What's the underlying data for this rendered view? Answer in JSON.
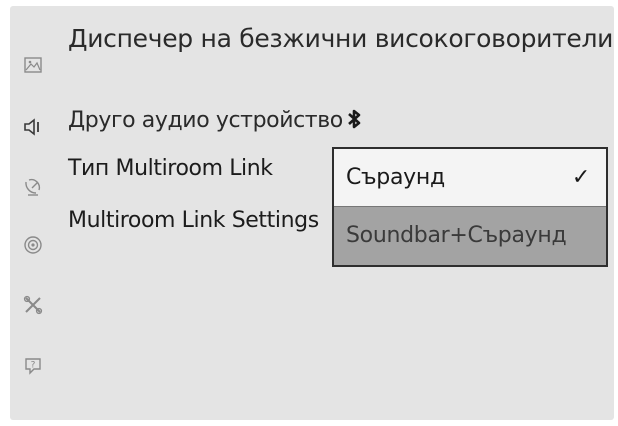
{
  "page": {
    "title": "Диспечер на безжични високоговорители"
  },
  "sidebar": {
    "icons": [
      "picture-icon",
      "sound-icon",
      "broadcast-icon",
      "network-icon",
      "tools-icon",
      "support-icon"
    ]
  },
  "menu": {
    "other_audio_device": "Друго аудио устройство",
    "multiroom_type_label": "Тип Multiroom Link",
    "multiroom_settings_label": "Multiroom Link Settings"
  },
  "dropdown": {
    "options": [
      {
        "label": "Съраунд",
        "selected": true,
        "check": "✓"
      },
      {
        "label": "Soundbar+Съраунд",
        "selected": false
      }
    ]
  },
  "colors": {
    "background": "#e4e4e4",
    "dropdown_selected": "#f4f4f4",
    "dropdown_other": "#a3a3a3"
  }
}
